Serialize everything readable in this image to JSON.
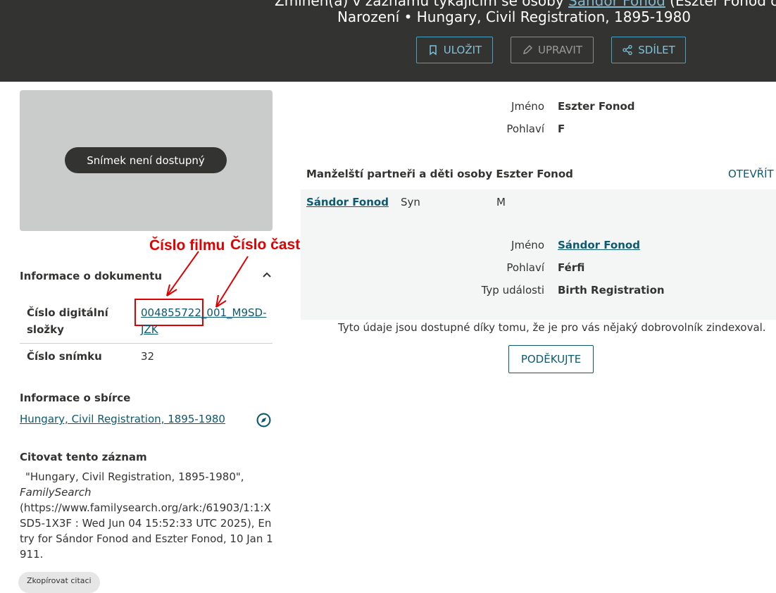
{
  "header": {
    "line1_prefix": "Zmíněn(a) v záznamu týkajícím se osoby ",
    "line1_link": "Sándor Fonod",
    "line1_suffix": " (Eszter Fonod oso",
    "line2": "Narození • Hungary, Civil Registration, 1895-1980",
    "buttons": {
      "save": "ULOŽIT",
      "edit": "UPRAVIT",
      "share": "SDÍLET"
    }
  },
  "image_panel": {
    "unavailable_label": "Snímek není dostupný"
  },
  "annotations": {
    "film_number": "Číslo filmu",
    "film_part_number": "Číslo časti filmu"
  },
  "document_info": {
    "title": "Informace o dokumentu",
    "folder_label_line1": "Číslo digitální",
    "folder_label_line2": "složky",
    "folder_value_main": "004855722",
    "folder_value_rest": "_001_M9SD-JZK",
    "image_number_label": "Číslo snímku",
    "image_number_value": "32"
  },
  "collection": {
    "title": "Informace o sbírce",
    "link": "Hungary, Civil Registration, 1895-1980"
  },
  "citation": {
    "title": "Citovat tento záznam",
    "quote_start": "\"Hungary, Civil Registration, 1895-1980\",",
    "source": "FamilySearch",
    "body": "(https://www.familysearch.org/ark:/61903/1:1:XSD5-1X3F : Wed Jun 04 15:52:33 UTC 2025), Entry for Sándor Fonod and Eszter Fonod, 10 Jan 1911.",
    "copy_button": "Zkopírovat citaci"
  },
  "person": {
    "name_label": "Jméno",
    "name_value": "Eszter Fonod",
    "sex_label": "Pohlaví",
    "sex_value": "F"
  },
  "spouses_children": {
    "heading": "Manželští partneři a děti osoby Eszter Fonod",
    "open_link": "OTEVŘÍT",
    "child": {
      "name": "Sándor Fonod",
      "relationship": "Syn",
      "sex": "M",
      "detail_name_label": "Jméno",
      "detail_name_value": "Sándor Fonod",
      "detail_sex_label": "Pohlaví",
      "detail_sex_value": "Férfi",
      "detail_event_label": "Typ události",
      "detail_event_value": "Birth Registration"
    }
  },
  "volunteer": {
    "text": "Tyto údaje jsou dostupné díky tomu, že je pro vás nějaký dobrovolník zindexoval.",
    "thank_button": "PODĚKUJTE"
  },
  "colors": {
    "header_bg": "#333331",
    "link": "#0b5a72",
    "annotation_red": "#e00000"
  }
}
